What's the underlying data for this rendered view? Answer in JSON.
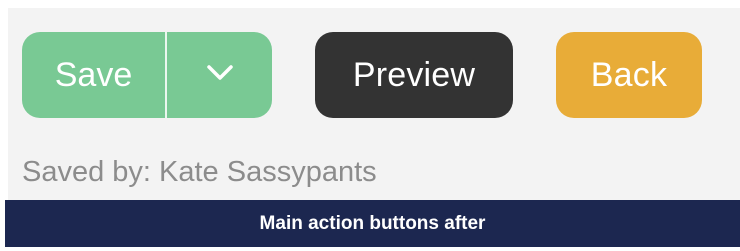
{
  "actions": {
    "save_label": "Save",
    "dropdown_icon": "chevron-down-icon",
    "preview_label": "Preview",
    "back_label": "Back"
  },
  "status": {
    "saved_by": "Saved by: Kate Sassypants"
  },
  "caption": {
    "text": "Main action buttons after"
  },
  "colors": {
    "save": "#79c994",
    "preview": "#333333",
    "back": "#e8ac38",
    "panel": "#f3f3f3",
    "caption_bg": "#1c2750",
    "muted_text": "#8c8c8c"
  }
}
